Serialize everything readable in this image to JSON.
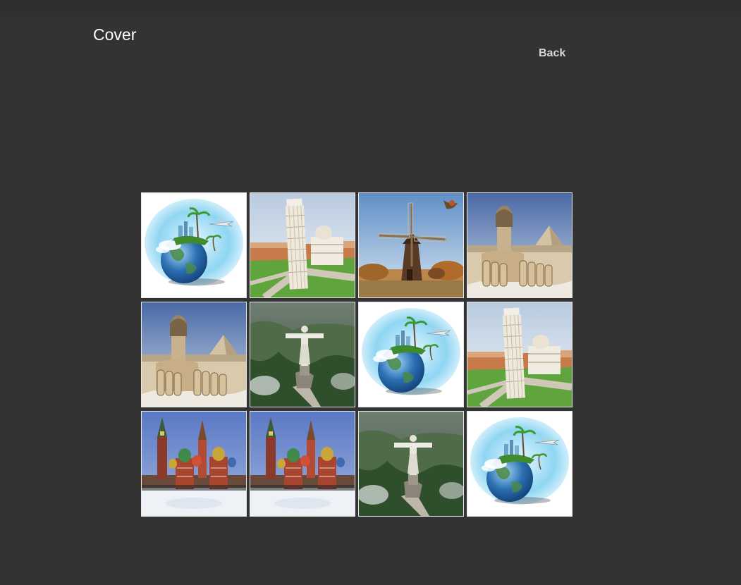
{
  "header": {
    "title": "Cover",
    "back_label": "Back"
  },
  "gallery": {
    "tiles": [
      {
        "subject": "globe-travel"
      },
      {
        "subject": "leaning-tower-pisa"
      },
      {
        "subject": "windmill"
      },
      {
        "subject": "sphinx"
      },
      {
        "subject": "sphinx"
      },
      {
        "subject": "christ-the-redeemer"
      },
      {
        "subject": "globe-travel"
      },
      {
        "subject": "leaning-tower-pisa"
      },
      {
        "subject": "kremlin"
      },
      {
        "subject": "kremlin"
      },
      {
        "subject": "christ-the-redeemer"
      },
      {
        "subject": "globe-travel"
      }
    ]
  }
}
